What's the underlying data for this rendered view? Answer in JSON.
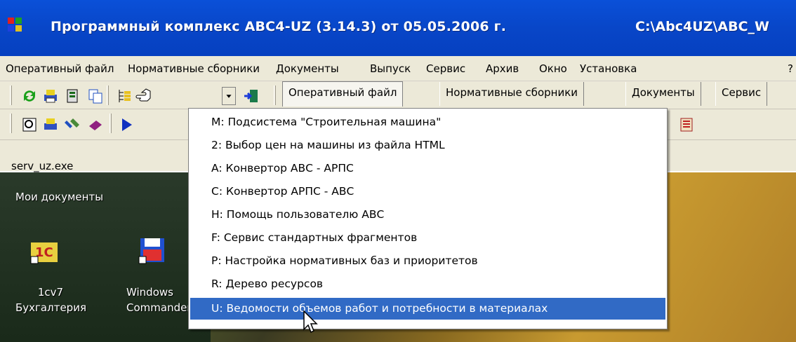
{
  "window": {
    "title": "Программный комплекс АВС4-UZ (3.14.3) от 05.05.2006 г.",
    "path": "C:\\Abc4UZ\\ABC_W"
  },
  "menubar": {
    "items": [
      "Оперативный файл",
      "Нормативные сборники",
      "Документы",
      "Выпуск",
      "Сервис",
      "Архив",
      "Окно",
      "Установка",
      "?"
    ]
  },
  "toolbar": {
    "tabs": [
      "Оперативный файл",
      "Нормативные сборники",
      "Документы",
      "Сервис"
    ]
  },
  "statusrow": {
    "program": "serv_uz.exe"
  },
  "desktop": {
    "icons": [
      {
        "label": "Мои документы"
      },
      {
        "label": "1cv7 Бухгалтерия"
      },
      {
        "label": "Windows Commander"
      }
    ]
  },
  "dropdown": {
    "items": [
      "M: Подсистема \"Строительная машина\"",
      "2: Выбор цен на машины из файла HTML",
      "A: Конвертор АВС - АРПС",
      "C: Конвертор АРПС - АВС",
      "H: Помощь пользователю АВС",
      "F: Сервис стандартных фрагментов",
      "P: Настройка нормативных баз и приоритетов",
      "R: Дерево ресурсов",
      "U: Ведомости объемов работ и потребности в материалах"
    ],
    "selected_index": 8
  },
  "colors": {
    "titlebar": "#0846c8",
    "menu_bg": "#ece9d8",
    "selection": "#316ac5"
  }
}
